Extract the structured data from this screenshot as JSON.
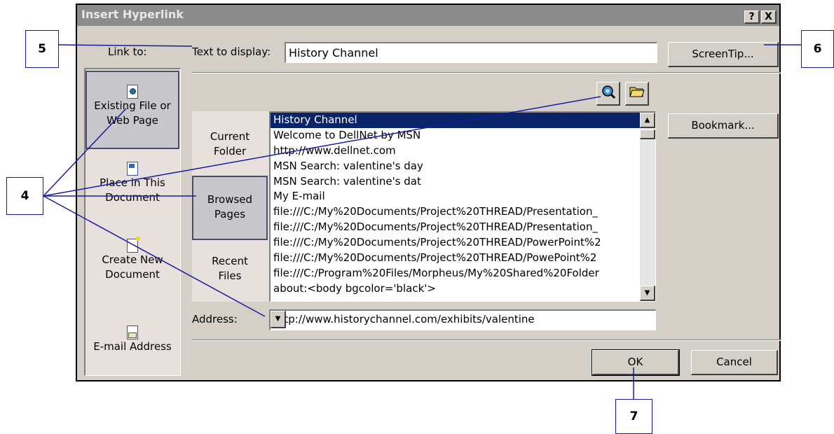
{
  "dialog": {
    "title": "Insert Hyperlink",
    "help_label": "?",
    "close_label": "X",
    "link_to_label": "Link to:",
    "text_to_display_label": "Text to display:",
    "text_to_display_value": "History Channel",
    "screentip_label": "ScreenTip...",
    "bookmark_label": "Bookmark...",
    "address_label": "Address:",
    "address_value": "http://www.historychannel.com/exhibits/valentine",
    "ok_label": "OK",
    "cancel_label": "Cancel"
  },
  "link_to": [
    {
      "line1": "Existing File or",
      "line2": "Web Page",
      "icon": "web-page-icon",
      "selected": true
    },
    {
      "line1": "Place in This",
      "line2": "Document",
      "icon": "place-in-document-icon",
      "selected": false
    },
    {
      "line1": "Create New",
      "line2": "Document",
      "icon": "new-document-icon",
      "selected": false
    },
    {
      "line1": "E-mail Address",
      "line2": "",
      "icon": "email-icon",
      "selected": false
    }
  ],
  "look_in_tabs": [
    {
      "line1": "Current",
      "line2": "Folder",
      "selected": false
    },
    {
      "line1": "Browsed",
      "line2": "Pages",
      "selected": true
    },
    {
      "line1": "Recent",
      "line2": "Files",
      "selected": false
    }
  ],
  "browsed_pages": [
    "History Channel",
    "Welcome to DellNet by MSN",
    "http://www.dellnet.com",
    "MSN Search: valentine's day",
    "MSN Search: valentine's dat",
    "My E-mail",
    "file:///C:/My%20Documents/Project%20THREAD/Presentation_",
    "file:///C:/My%20Documents/Project%20THREAD/Presentation_",
    "file:///C:/My%20Documents/Project%20THREAD/PowerPoint%2",
    "file:///C:/My%20Documents/Project%20THREAD/PowePoint%2",
    "file:///C:/Program%20Files/Morpheus/My%20Shared%20Folder",
    "about:<body bgcolor='black'>"
  ],
  "callouts": {
    "c4": "4",
    "c5": "5",
    "c6": "6",
    "c7": "7"
  },
  "colors": {
    "selection": "#0a246a",
    "callout_line": "#1a1aa0",
    "titlebar": "#8c8c8c"
  }
}
